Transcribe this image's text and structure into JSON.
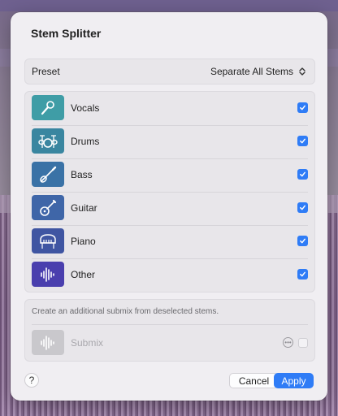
{
  "dialog": {
    "title": "Stem Splitter",
    "preset": {
      "label": "Preset",
      "value": "Separate All Stems"
    },
    "stems": [
      {
        "label": "Vocals",
        "icon": "microphone-icon",
        "color": "#3f9da6",
        "checked": true
      },
      {
        "label": "Drums",
        "icon": "drum-kit-icon",
        "color": "#3a86a0",
        "checked": true
      },
      {
        "label": "Bass",
        "icon": "bass-guitar-icon",
        "color": "#3a72a6",
        "checked": true
      },
      {
        "label": "Guitar",
        "icon": "guitar-icon",
        "color": "#3f66a8",
        "checked": true
      },
      {
        "label": "Piano",
        "icon": "piano-icon",
        "color": "#3f55a2",
        "checked": true
      },
      {
        "label": "Other",
        "icon": "waveform-icon",
        "color": "#4a3fae",
        "checked": true
      }
    ],
    "submix": {
      "hint": "Create an additional submix from deselected stems.",
      "label": "Submix",
      "icon": "waveform-icon",
      "checked": false
    },
    "buttons": {
      "help": "?",
      "cancel": "Cancel",
      "apply": "Apply"
    }
  },
  "colors": {
    "accent": "#2f7cf6",
    "dialog_bg": "#f0eef2"
  }
}
